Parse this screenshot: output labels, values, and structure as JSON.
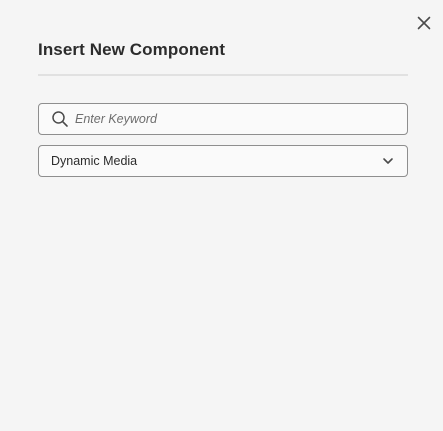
{
  "dialog": {
    "title": "Insert New Component",
    "close_icon": "close-icon"
  },
  "search": {
    "placeholder": "Enter Keyword",
    "value": "",
    "icon": "search-icon"
  },
  "group_select": {
    "selected": "Dynamic Media",
    "icon": "chevron-down-icon"
  }
}
